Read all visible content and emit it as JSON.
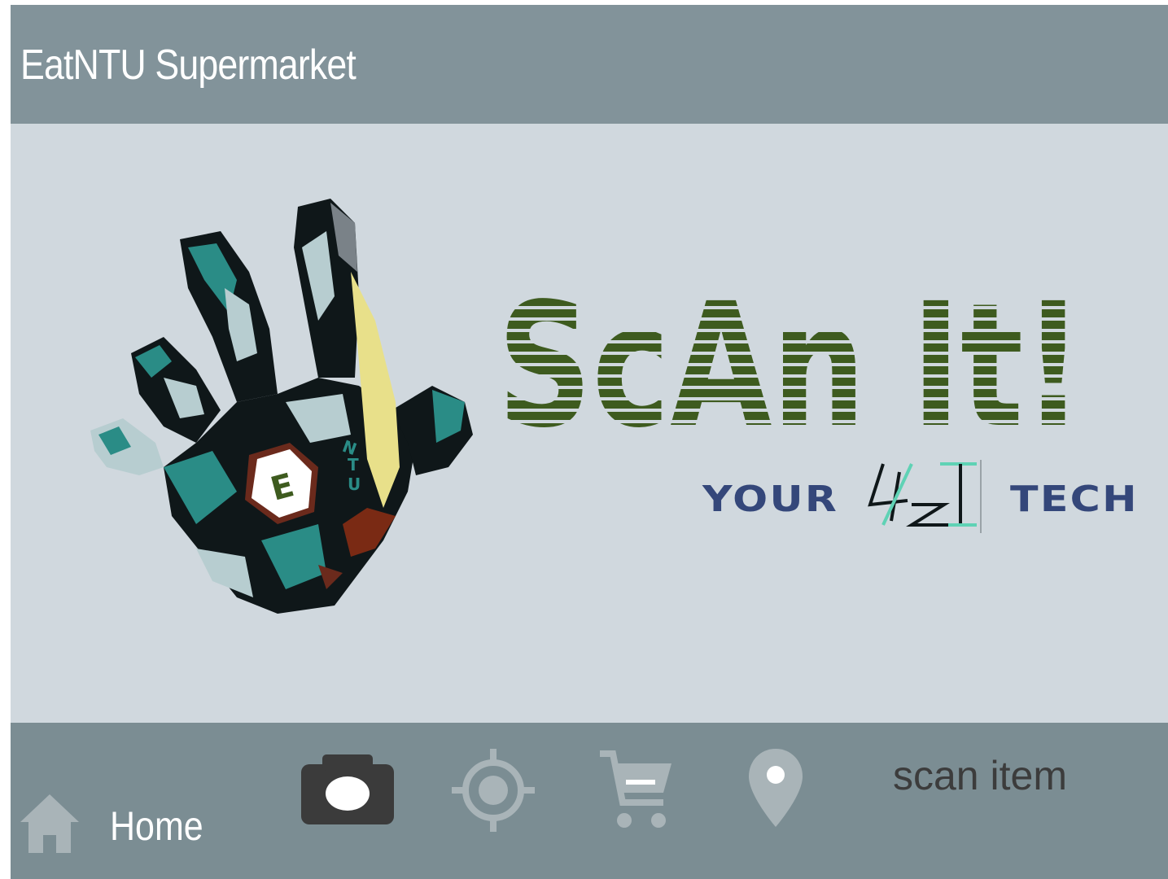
{
  "header": {
    "title": "EatNTU Supermarket"
  },
  "logo": {
    "hand_letters": [
      "E",
      "N",
      "T",
      "U"
    ],
    "wordmark": "ScAn It!",
    "tagline": [
      "YOUR",
      "TECH"
    ],
    "tagline_mark": "LAZI",
    "colors": {
      "wordmark": "#3e5b1f",
      "tagline": "#34477a",
      "hand_teal": "#2a8c86",
      "hand_dark": "#0f1719"
    }
  },
  "bottom_bar": {
    "home_label": "Home",
    "status_text": "scan item",
    "icons": [
      "home-icon",
      "camera-icon",
      "target-icon",
      "cart-icon",
      "location-pin-icon"
    ]
  }
}
